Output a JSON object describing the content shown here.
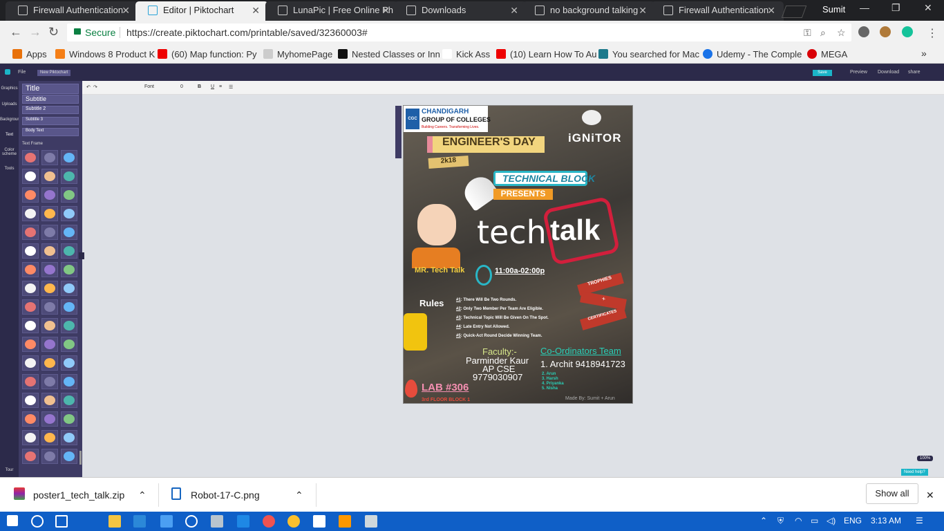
{
  "browser": {
    "tabs": [
      {
        "title": "Firewall Authentication"
      },
      {
        "title": "Editor | Piktochart"
      },
      {
        "title": "LunaPic | Free Online Ph"
      },
      {
        "title": "Downloads"
      },
      {
        "title": "no background talking"
      },
      {
        "title": "Firewall Authentication"
      }
    ],
    "user": "Sumit",
    "secure_label": "Secure",
    "url": "https://create.piktochart.com/printable/saved/32360003#",
    "bookmarks": [
      "Apps",
      "Windows 8 Product K",
      "(60) Map function: Py",
      "MyhomePage",
      "Nested Classes or Inn",
      "Kick Ass",
      "(10) Learn How To Au",
      "You searched for Mac",
      "Udemy - The Comple",
      "MEGA"
    ]
  },
  "app": {
    "file_menu": "File",
    "new_button": "New Piktochart",
    "save_button": "Save",
    "preview": "Preview",
    "download": "Download",
    "share": "share",
    "font_placeholder": "Font",
    "font_size": "0",
    "sidebar": [
      "Graphics",
      "Uploads",
      "Background",
      "Text",
      "Color scheme",
      "Tools"
    ],
    "tour": "Tour",
    "text_styles": [
      "Title",
      "Subtitle",
      "Subtitle 2",
      "Subtitle 3",
      "Body Text"
    ],
    "text_frame_label": "Text Frame",
    "zoom": "100%",
    "need_help": "Need help?"
  },
  "poster": {
    "college_line1": "CHANDIGARH",
    "college_line2": "GROUP OF COLLEGES",
    "college_tagline": "Building Careers. Transforming Lives.",
    "logo_letters": "CGC",
    "event_banner": "ENGINEER'S DAY",
    "year": "2k18",
    "ignitor": "iGNiTOR",
    "tech_block": "TECHNICAL BLOCK",
    "presents": "PRESENTS",
    "tech": "tech",
    "talk": "talk",
    "mr_tech_talk": "MR. Tech Talk",
    "time": "11:00a-02:00p",
    "rules_title": "Rules",
    "rules": [
      ": There Will Be Two Rounds.",
      ": Only Two Member Per Team Are Eligible.",
      ": Technical Topic Will Be Given On The Spot.",
      ": Late Entry Not Allowed.",
      ": Quick-Act Round Decide Winning Team."
    ],
    "rule_prefixes": [
      "#1",
      "#2",
      "#3",
      "#4",
      "#5"
    ],
    "trophies": "TROPHIES",
    "plus": "+",
    "certificates": "CERTIFICATES",
    "faculty_label": "Faculty:-",
    "faculty_name": "Parminder Kaur",
    "faculty_dept": "AP CSE",
    "faculty_phone": "9779030907",
    "coord_label": "Co-Ordinators Team",
    "coord_1": "1. Archit 9418941723",
    "coord_rest": [
      "2. Arun",
      "3. Harsh",
      "4. Priyanka",
      "5. Nisha"
    ],
    "lab": "LAB #306",
    "floor": "3rd FLOOR BLOCK 1",
    "made_by": "Made By: Sumit + Arun"
  },
  "downloads": [
    {
      "name": "poster1_tech_talk.zip"
    },
    {
      "name": "Robot-17-C.png"
    }
  ],
  "show_all": "Show all",
  "taskbar": {
    "lang": "ENG",
    "time": "3:13 AM"
  },
  "colors": {
    "accent": "#1bb5c8",
    "editor_dark": "#2c2a4a",
    "panel": "#3e3b64"
  }
}
